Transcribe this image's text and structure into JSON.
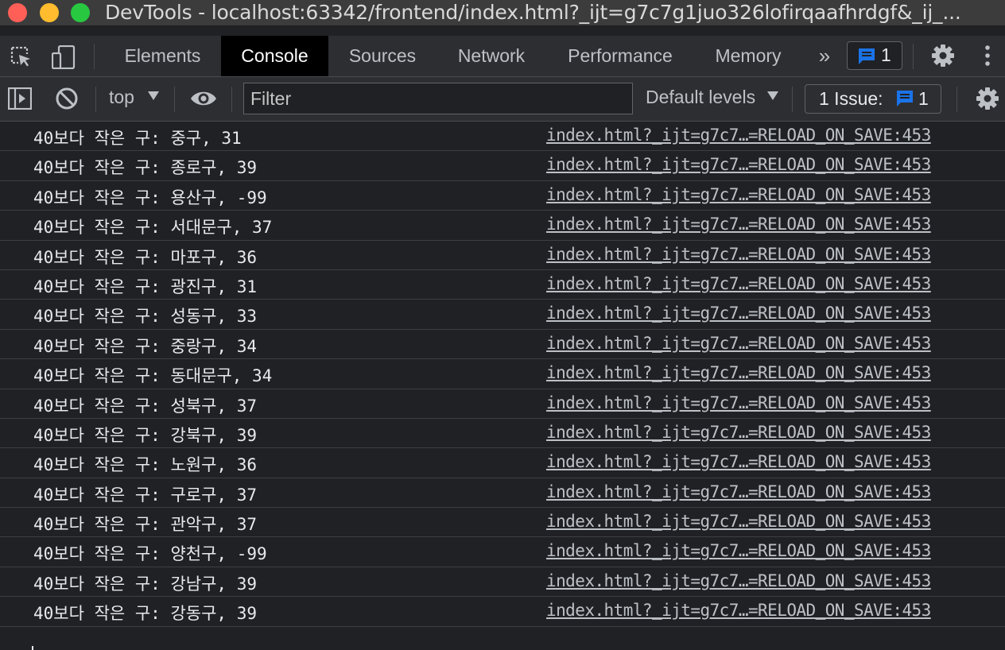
{
  "window": {
    "title": "DevTools - localhost:63342/frontend/index.html?_ijt=g7c7g1juo326lofirqaafhrdgf&_ij_..."
  },
  "tabs": [
    {
      "label": "Elements",
      "active": false
    },
    {
      "label": "Console",
      "active": true
    },
    {
      "label": "Sources",
      "active": false
    },
    {
      "label": "Network",
      "active": false
    },
    {
      "label": "Performance",
      "active": false
    },
    {
      "label": "Memory",
      "active": false
    }
  ],
  "tabbar": {
    "more": "»",
    "issues_count": "1"
  },
  "toolbar": {
    "context": "top",
    "filter_placeholder": "Filter",
    "levels": "Default levels",
    "issues_label": "1 Issue:",
    "issues_count": "1"
  },
  "colors": {
    "accent": "#1a73e8",
    "background": "#202124",
    "toolbar": "#2d2e31"
  },
  "icons": {
    "inspect": "inspect-element-icon",
    "device": "device-toolbar-icon",
    "settings": "gear-icon",
    "menu": "more-vert-icon",
    "sidebar": "sidebar-toggle-icon",
    "clear": "clear-console-icon",
    "eye": "live-expression-icon",
    "issue": "message-icon"
  },
  "console": {
    "rows": [
      {
        "message": "40보다 작은 구: 중구, 31",
        "source": "index.html?_ijt=g7c7…=RELOAD_ON_SAVE:453"
      },
      {
        "message": "40보다 작은 구: 종로구, 39",
        "source": "index.html?_ijt=g7c7…=RELOAD_ON_SAVE:453"
      },
      {
        "message": "40보다 작은 구: 용산구, -99",
        "source": "index.html?_ijt=g7c7…=RELOAD_ON_SAVE:453"
      },
      {
        "message": "40보다 작은 구: 서대문구, 37",
        "source": "index.html?_ijt=g7c7…=RELOAD_ON_SAVE:453"
      },
      {
        "message": "40보다 작은 구: 마포구, 36",
        "source": "index.html?_ijt=g7c7…=RELOAD_ON_SAVE:453"
      },
      {
        "message": "40보다 작은 구: 광진구, 31",
        "source": "index.html?_ijt=g7c7…=RELOAD_ON_SAVE:453"
      },
      {
        "message": "40보다 작은 구: 성동구, 33",
        "source": "index.html?_ijt=g7c7…=RELOAD_ON_SAVE:453"
      },
      {
        "message": "40보다 작은 구: 중랑구, 34",
        "source": "index.html?_ijt=g7c7…=RELOAD_ON_SAVE:453"
      },
      {
        "message": "40보다 작은 구: 동대문구, 34",
        "source": "index.html?_ijt=g7c7…=RELOAD_ON_SAVE:453"
      },
      {
        "message": "40보다 작은 구: 성북구, 37",
        "source": "index.html?_ijt=g7c7…=RELOAD_ON_SAVE:453"
      },
      {
        "message": "40보다 작은 구: 강북구, 39",
        "source": "index.html?_ijt=g7c7…=RELOAD_ON_SAVE:453"
      },
      {
        "message": "40보다 작은 구: 노원구, 36",
        "source": "index.html?_ijt=g7c7…=RELOAD_ON_SAVE:453"
      },
      {
        "message": "40보다 작은 구: 구로구, 37",
        "source": "index.html?_ijt=g7c7…=RELOAD_ON_SAVE:453"
      },
      {
        "message": "40보다 작은 구: 관악구, 37",
        "source": "index.html?_ijt=g7c7…=RELOAD_ON_SAVE:453"
      },
      {
        "message": "40보다 작은 구: 양천구, -99",
        "source": "index.html?_ijt=g7c7…=RELOAD_ON_SAVE:453"
      },
      {
        "message": "40보다 작은 구: 강남구, 39",
        "source": "index.html?_ijt=g7c7…=RELOAD_ON_SAVE:453"
      },
      {
        "message": "40보다 작은 구: 강동구, 39",
        "source": "index.html?_ijt=g7c7…=RELOAD_ON_SAVE:453"
      }
    ]
  }
}
